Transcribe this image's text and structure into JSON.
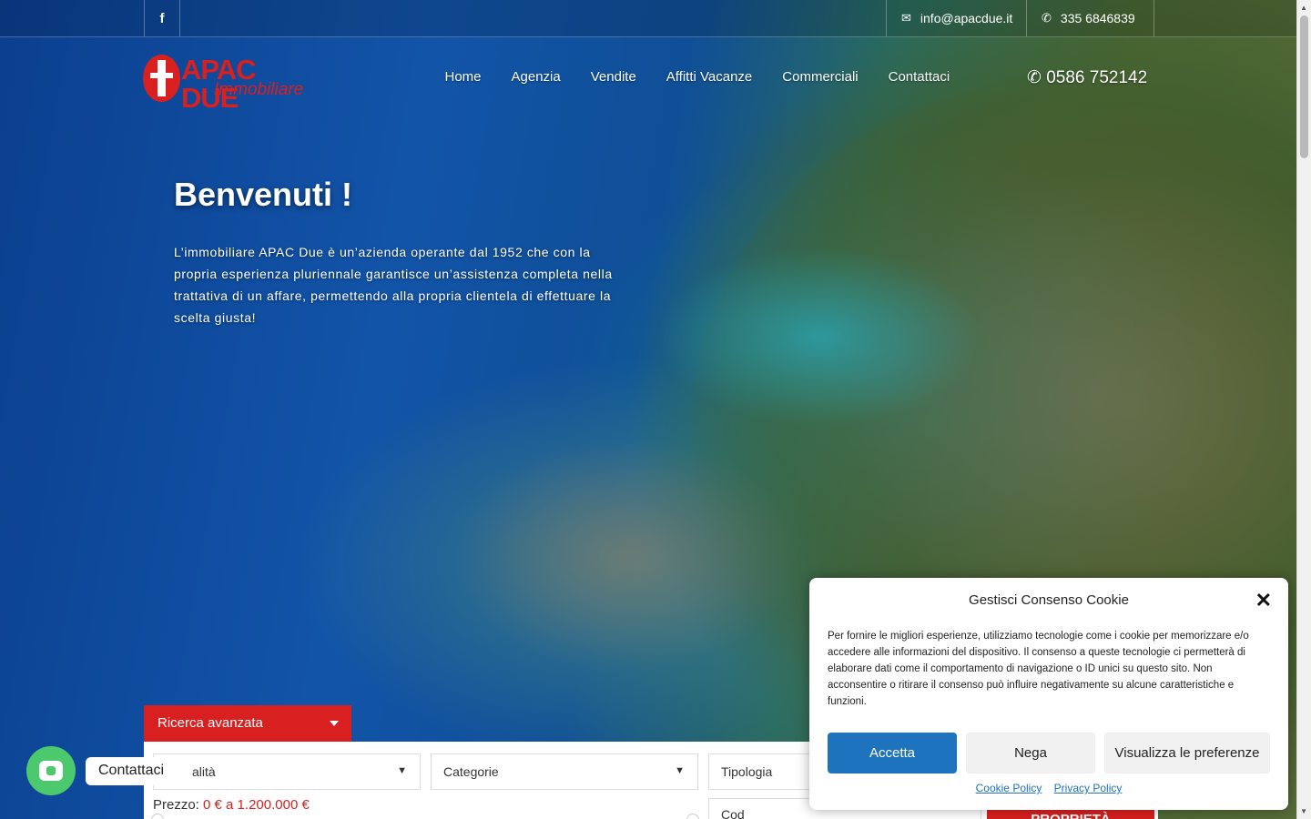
{
  "topbar": {
    "facebook_icon": "f",
    "email": "info@apacdue.it",
    "whatsapp": "335 6846839"
  },
  "logo": {
    "main": "APAC DUE",
    "sub": "Immobiliare"
  },
  "nav": {
    "items": [
      "Home",
      "Agenzia",
      "Vendite",
      "Affitti Vacanze",
      "Commerciali",
      "Contattaci"
    ]
  },
  "phone": "0586 752142",
  "hero": {
    "title": "Benvenuti !",
    "text": "L’immobiliare APAC Due è un’azienda operante dal 1952 che con la propria esperienza pluriennale garantisce un’assistenza completa nella trattativa di un affare, permettendo alla propria clientela di effettuare la scelta giusta!"
  },
  "search": {
    "tab_label": "Ricerca avanzata",
    "locality_placeholder": "Località",
    "locality_visible": "alità",
    "category": "Categorie",
    "type": "Tipologia",
    "price_label": "Prezzo:",
    "price_range": "0 € a 1.200.000 €",
    "code_placeholder": "Cod",
    "submit_label": "PROPRIETÀ"
  },
  "cookie": {
    "title": "Gestisci Consenso Cookie",
    "text": "Per fornire le migliori esperienze, utilizziamo tecnologie come i cookie per memorizzare e/o accedere alle informazioni del dispositivo. Il consenso a queste tecnologie ci permetterà di elaborare dati come il comportamento di navigazione o ID unici su questo sito. Non acconsentire o ritirare il consenso può influire negativamente su alcune caratteristiche e funzioni.",
    "accept": "Accetta",
    "deny": "Nega",
    "preferences": "Visualizza le preferenze",
    "cookie_policy": "Cookie Policy",
    "privacy_policy": "Privacy Policy"
  },
  "chat": {
    "label": "Contattaci"
  },
  "colors": {
    "brand_red": "#d7201f",
    "accept_blue": "#1e73be",
    "chat_green": "#4cc96c"
  }
}
